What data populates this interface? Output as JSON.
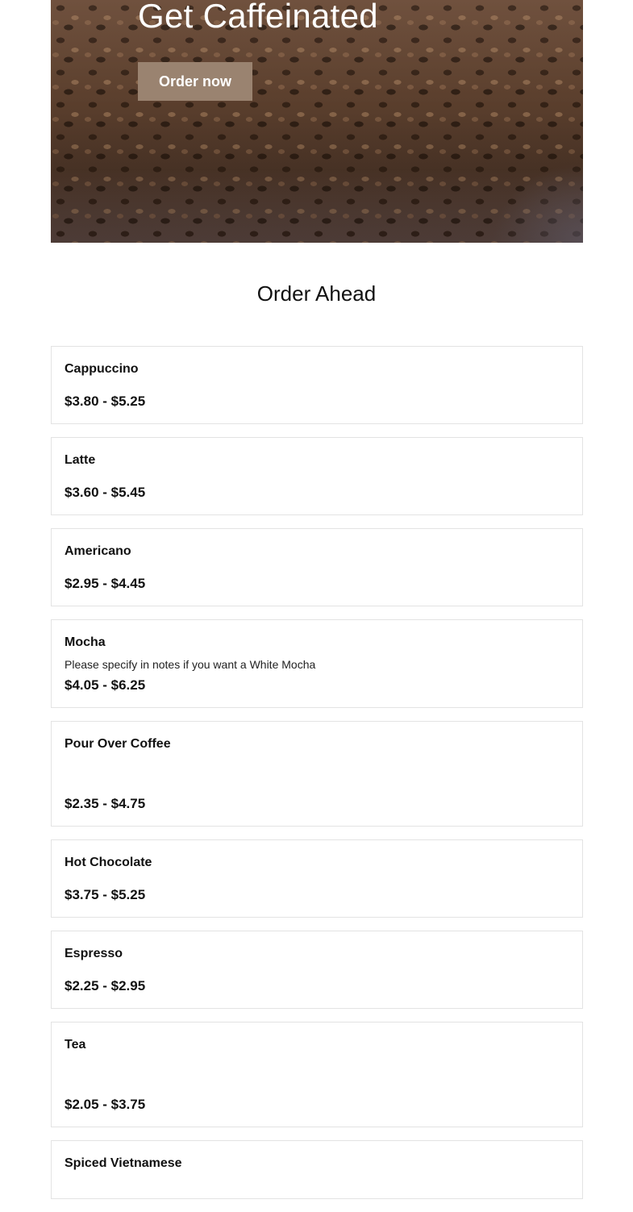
{
  "hero": {
    "title": "Get Caffeinated",
    "button_label": "Order now"
  },
  "section": {
    "title": "Order Ahead"
  },
  "menu_items": [
    {
      "name": "Cappuccino",
      "description": "",
      "price": "$3.80 - $5.25"
    },
    {
      "name": "Latte",
      "description": "",
      "price": "$3.60 - $5.45"
    },
    {
      "name": "Americano",
      "description": "",
      "price": "$2.95 - $4.45"
    },
    {
      "name": "Mocha",
      "description": "Please specify in notes if you want a White Mocha",
      "price": "$4.05 - $6.25"
    },
    {
      "name": "Pour Over Coffee",
      "description": "",
      "price": "$2.35 - $4.75"
    },
    {
      "name": "Hot Chocolate",
      "description": "",
      "price": "$3.75 - $5.25"
    },
    {
      "name": "Espresso",
      "description": "",
      "price": "$2.25 - $2.95"
    },
    {
      "name": "Tea",
      "description": "",
      "price": "$2.05 - $3.75"
    },
    {
      "name": "Spiced Vietnamese",
      "description": "",
      "price": ""
    }
  ],
  "colors": {
    "button_background": "#9a8370",
    "card_border": "#e3e3e3"
  }
}
